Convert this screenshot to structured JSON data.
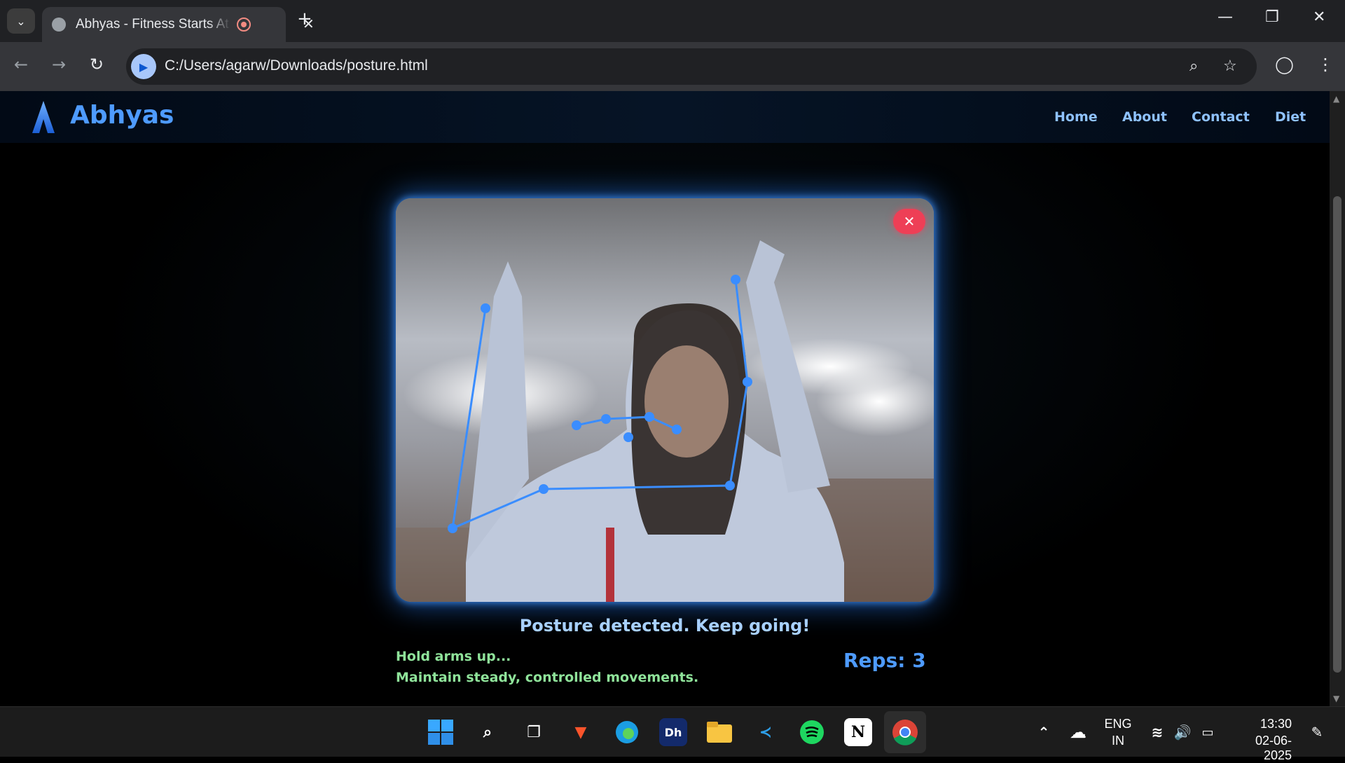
{
  "browser": {
    "tab_title": "Abhyas - Fitness Starts At Home",
    "url": "C:/Users/agarw/Downloads/posture.html"
  },
  "site": {
    "brand": "Abhyas",
    "nav": [
      "Home",
      "About",
      "Contact",
      "Diet"
    ]
  },
  "detector": {
    "close_label": "✕",
    "status": "Posture detected. Keep going!",
    "hint_line1": "Hold arms up...",
    "hint_line2": "Maintain steady, controlled movements.",
    "reps": "Reps: 3"
  },
  "taskbar": {
    "lang": "ENG",
    "region": "IN",
    "time": "13:30",
    "date": "02-06-2025"
  },
  "colors": {
    "accent": "#4e9bff",
    "hint": "#8fe39a",
    "close": "#ee3f56"
  }
}
